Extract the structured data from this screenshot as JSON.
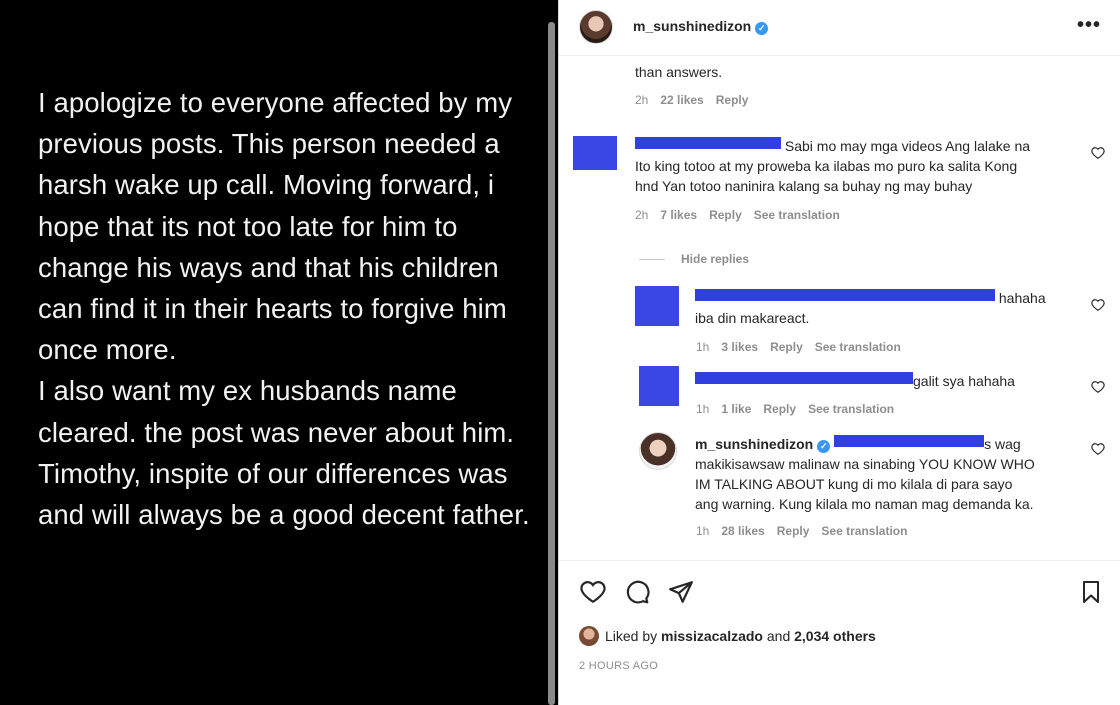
{
  "story": {
    "text": "I apologize to everyone affected by my previous posts. This person needed a harsh wake up call. Moving forward, i hope that its not too late for him to change his ways and that his children can find it in their hearts to forgive him once more.\nI also want my ex husbands name cleared. the post was never about him. Timothy, inspite of our differences was and will always be a good decent father."
  },
  "post": {
    "username": "m_sunshinedizon",
    "verified_glyph": "✓",
    "more_glyph": "•••"
  },
  "comments": {
    "c0": {
      "text": "than answers.",
      "time": "2h",
      "likes": "22 likes",
      "reply": "Reply"
    },
    "c1": {
      "text_a": "Sabi mo may mga videos Ang lalake na",
      "text_b": "Ito king totoo at my proweba ka ilabas mo puro ka salita Kong",
      "text_c": "hnd Yan totoo naninira kalang sa buhay ng may buhay",
      "time": "2h",
      "likes": "7 likes",
      "reply": "Reply",
      "translate": "See translation"
    },
    "hide_replies": "Hide replies",
    "r1": {
      "text_a": "hahaha",
      "text_b": "iba din makareact.",
      "time": "1h",
      "likes": "3 likes",
      "reply": "Reply",
      "translate": "See translation"
    },
    "r2": {
      "text_a": "galit sya hahaha",
      "time": "1h",
      "likes": "1 like",
      "reply": "Reply",
      "translate": "See translation"
    },
    "r3": {
      "username": "m_sunshinedizon",
      "text_a": "s wag",
      "text_b": "makikisawsaw malinaw na sinabing YOU KNOW WHO",
      "text_c": "IM TALKING ABOUT kung di mo kilala di para sayo",
      "text_d": "ang warning. Kung kilala mo naman mag demanda ka.",
      "time": "1h",
      "likes": "28 likes",
      "reply": "Reply",
      "translate": "See translation"
    }
  },
  "footer": {
    "liked_prefix": "Liked by",
    "liked_user": "missizacalzado",
    "liked_and": "and",
    "liked_count": "2,034 others",
    "timestamp": "2 HOURS AGO"
  },
  "colors": {
    "redaction": "#2f3fe0",
    "verified": "#3897f0"
  }
}
